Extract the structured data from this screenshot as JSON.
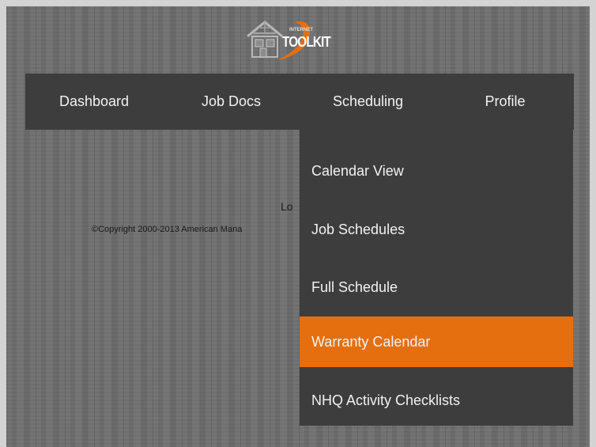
{
  "logo": {
    "text": "TOOLKIT",
    "small_text": "INTERNET",
    "icon": "house-logo-icon",
    "accent_color": "#e56f0e"
  },
  "nav": {
    "items": [
      {
        "label": "Dashboard"
      },
      {
        "label": "Job Docs"
      },
      {
        "label": "Scheduling"
      },
      {
        "label": "Profile"
      }
    ]
  },
  "dropdown": {
    "items": [
      {
        "label": "Calendar View",
        "active": false
      },
      {
        "label": "Job Schedules",
        "active": false
      },
      {
        "label": "Full Schedule",
        "active": false
      },
      {
        "label": "Warranty Calendar",
        "active": true
      },
      {
        "label": "NHQ Activity Checklists",
        "active": false
      }
    ],
    "highlight_color": "#e56f0e"
  },
  "footer": {
    "logout_visible": "Lo",
    "copyright_visible": "©Copyright 2000-2013 American Mana"
  }
}
